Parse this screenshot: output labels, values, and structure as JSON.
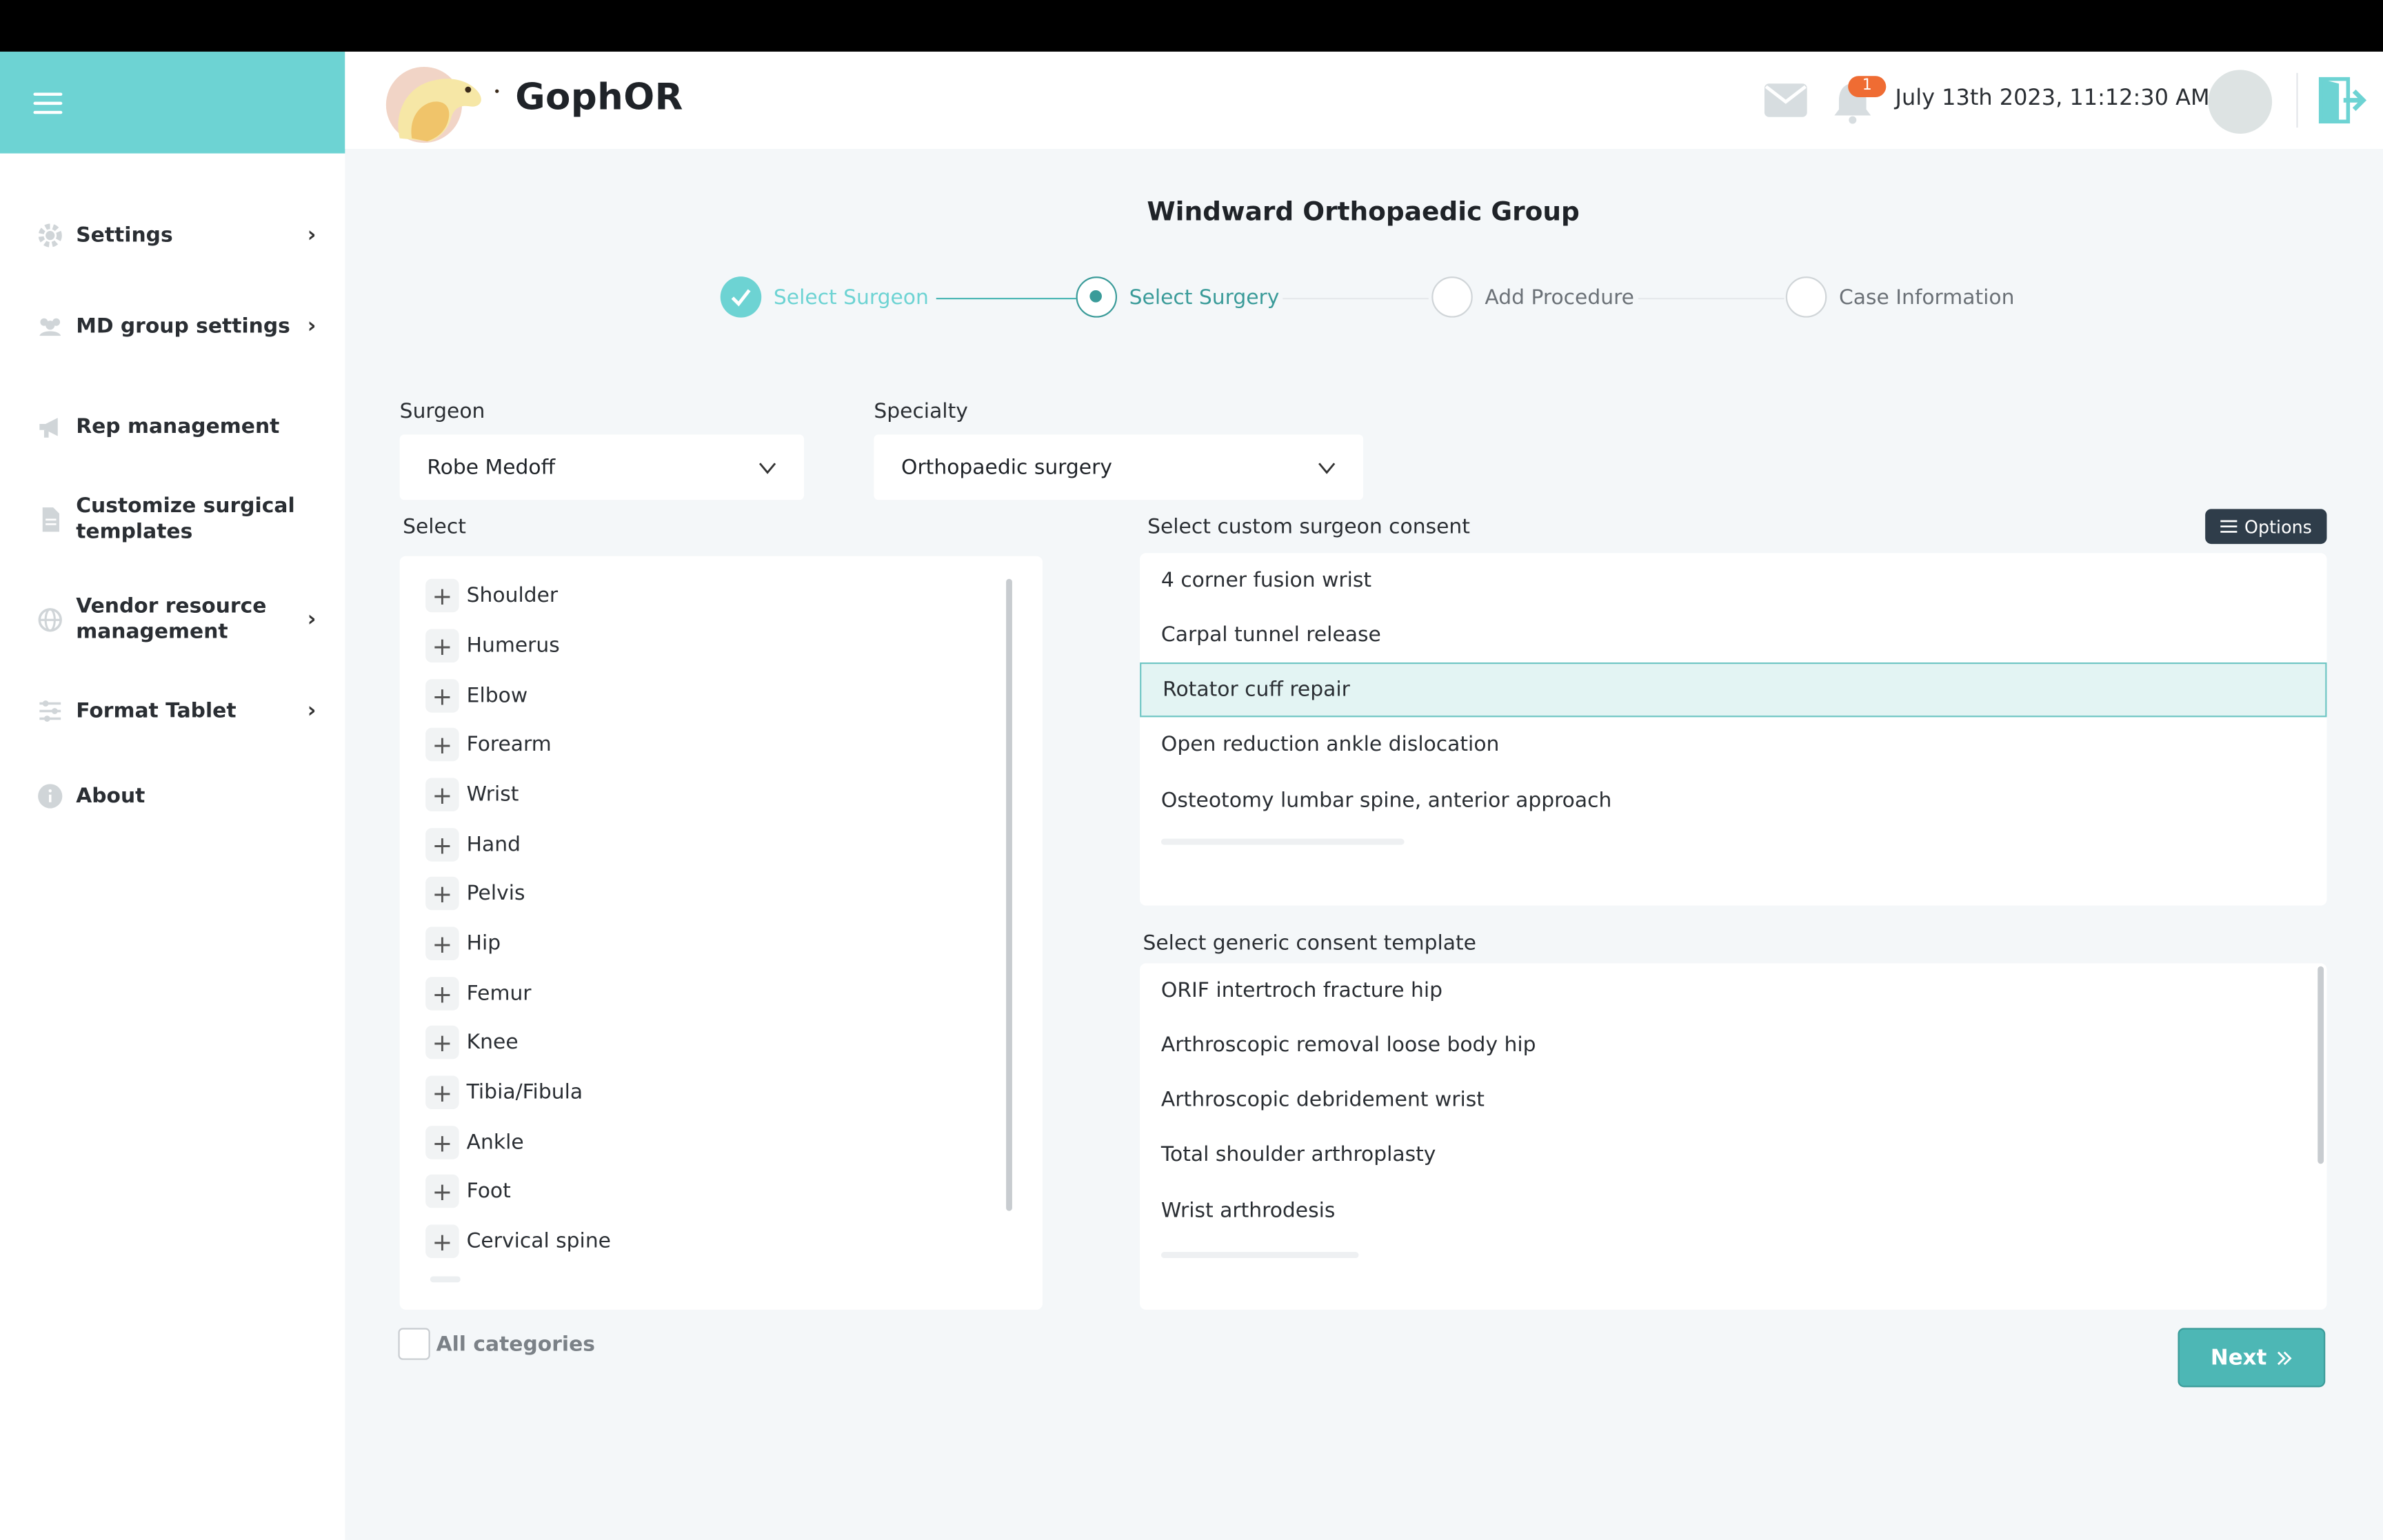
{
  "header": {
    "brand": "GophOR",
    "notification_count": "1",
    "datetime": "July 13th 2023, 11:12:30 AM"
  },
  "sidebar": {
    "items": [
      {
        "label": "Settings"
      },
      {
        "label": "MD group settings"
      },
      {
        "label": "Rep management"
      },
      {
        "label": "Customize surgical templates"
      },
      {
        "label": "Vendor resource management"
      },
      {
        "label": "Format Tablet"
      },
      {
        "label": "About"
      }
    ]
  },
  "main": {
    "title": "Windward Orthopaedic Group",
    "steps": [
      {
        "label": "Select Surgeon",
        "state": "done"
      },
      {
        "label": "Select Surgery",
        "state": "active"
      },
      {
        "label": "Add Procedure",
        "state": "todo"
      },
      {
        "label": "Case Information",
        "state": "todo"
      }
    ],
    "surgeon": {
      "label": "Surgeon",
      "value": "Robe Medoff"
    },
    "specialty": {
      "label": "Specialty",
      "value": "Orthopaedic surgery"
    },
    "categories": {
      "label": "Select",
      "items": [
        "Shoulder",
        "Humerus",
        "Elbow",
        "Forearm",
        "Wrist",
        "Hand",
        "Pelvis",
        "Hip",
        "Femur",
        "Knee",
        "Tibia/Fibula",
        "Ankle",
        "Foot",
        "Cervical spine"
      ]
    },
    "custom_consent": {
      "label": "Select custom surgeon consent",
      "options_label": "Options",
      "items": [
        "4 corner fusion wrist",
        "Carpal tunnel release",
        "Rotator cuff repair",
        "Open reduction ankle dislocation",
        "Osteotomy lumbar spine, anterior approach"
      ],
      "selected": "Rotator cuff repair"
    },
    "generic_consent": {
      "label": "Select generic consent template",
      "items": [
        "ORIF intertroch fracture hip",
        "Arthroscopic removal loose body hip",
        "Arthroscopic debridement wrist",
        "Total shoulder arthroplasty",
        "Wrist arthrodesis"
      ]
    },
    "all_categories_label": "All categories",
    "next_label": "Next"
  },
  "colors": {
    "accent": "#6dd3d3",
    "primary_button": "#4db7b5",
    "badge": "#ef6c33",
    "options_button": "#2f3d4a"
  }
}
